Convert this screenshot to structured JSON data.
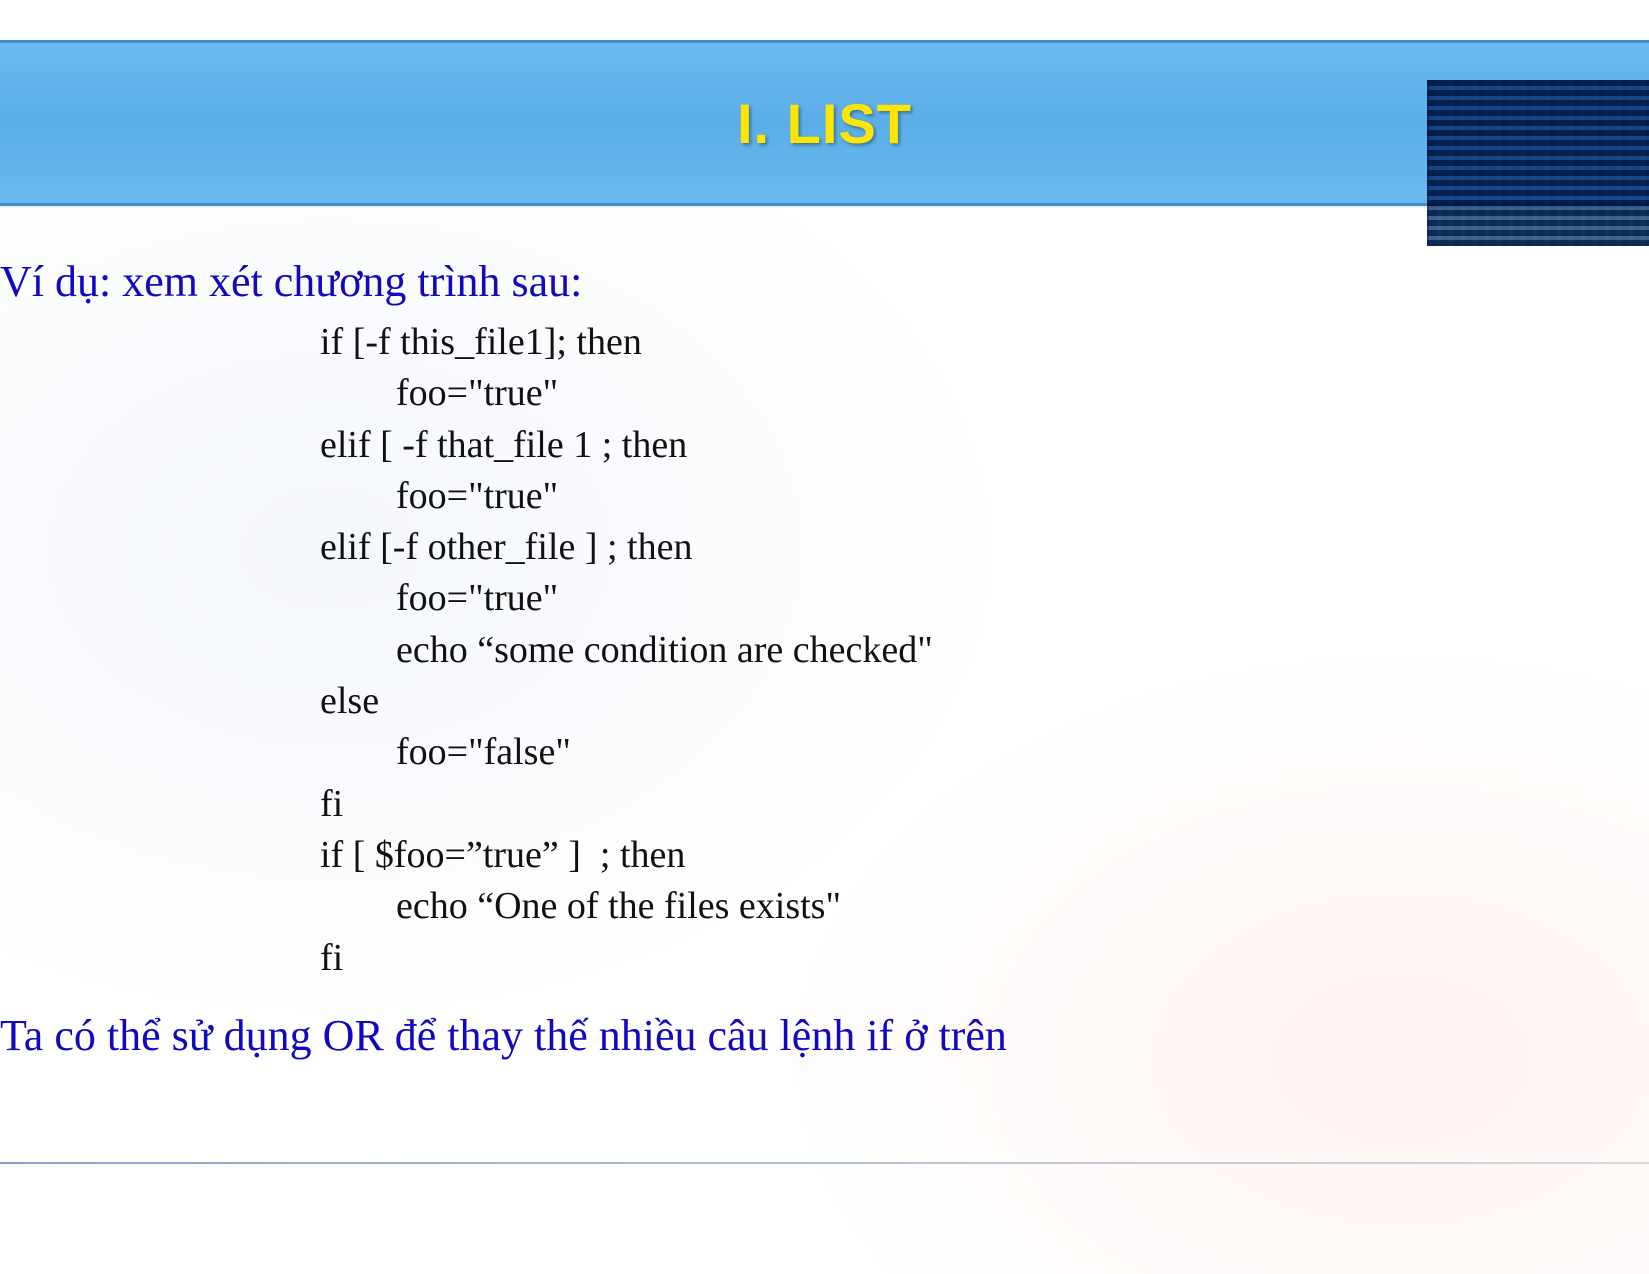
{
  "title": "I. LIST",
  "lead": "Ví dụ: xem xét chương trình sau:",
  "code_lines": [
    "if [-f this_file1]; then",
    "        foo=\"true\"",
    "elif [ -f that_file 1 ; then",
    "        foo=\"true\"",
    "elif [-f other_file ] ; then",
    "        foo=\"true\"",
    "        echo “some condition are checked\"",
    "else",
    "        foo=\"false\"",
    "fi",
    "if [ $foo=”true” ]  ; then",
    "        echo “One of the files exists\"",
    "fi"
  ],
  "footer": "Ta có thể sử dụng OR để thay thế nhiều câu lệnh if ở trên"
}
